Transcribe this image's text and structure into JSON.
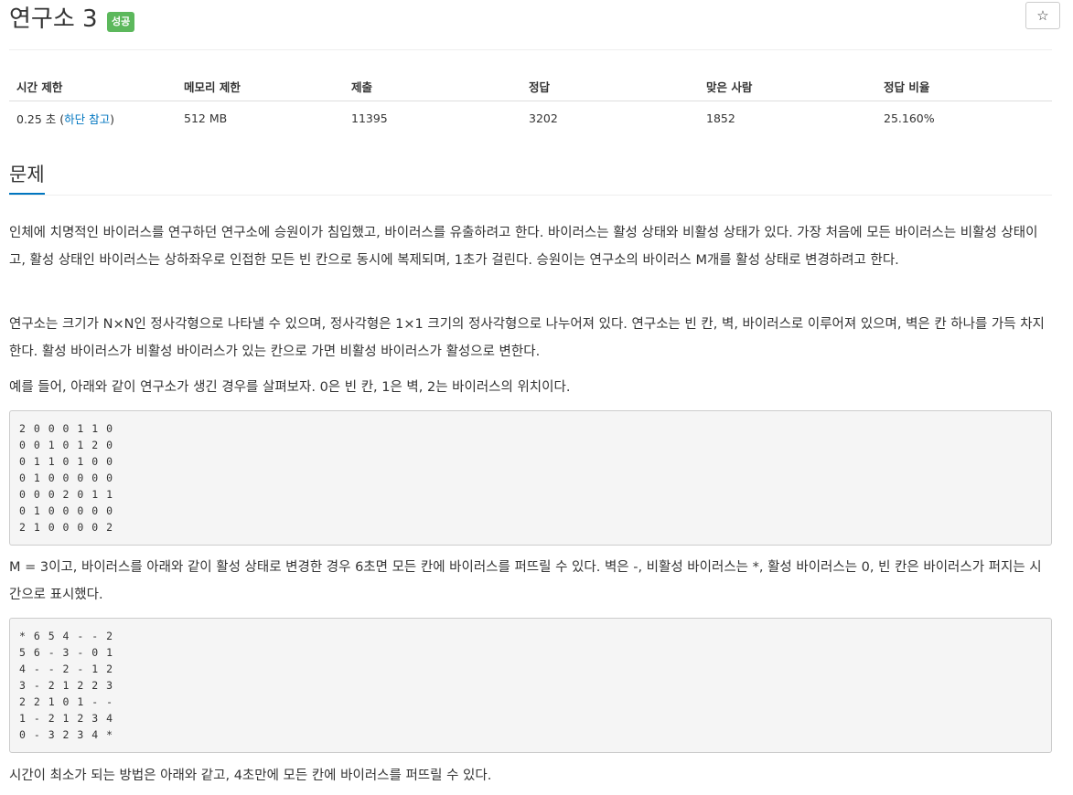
{
  "header": {
    "title": "연구소 3",
    "badge": "성공",
    "star_icon": "☆"
  },
  "info_table": {
    "headers": [
      "시간 제한",
      "메모리 제한",
      "제출",
      "정답",
      "맞은 사람",
      "정답 비율"
    ],
    "time_limit_value": "0.25 초 (",
    "time_limit_link": "하단 참고",
    "time_limit_close": ")",
    "memory_limit": "512 MB",
    "submissions": "11395",
    "accepted": "3202",
    "solvers": "1852",
    "ratio": "25.160%"
  },
  "section": {
    "title": "문제"
  },
  "paragraphs": {
    "p1": "인체에 치명적인 바이러스를 연구하던 연구소에 승원이가 침입했고, 바이러스를 유출하려고 한다. 바이러스는 활성 상태와 비활성 상태가 있다. 가장 처음에 모든 바이러스는 비활성 상태이고, 활성 상태인 바이러스는 상하좌우로 인접한 모든 빈 칸으로 동시에 복제되며, 1초가 걸린다. 승원이는 연구소의 바이러스 M개를 활성 상태로 변경하려고 한다.",
    "p2": "연구소는 크기가 N×N인 정사각형으로 나타낼 수 있으며, 정사각형은 1×1 크기의 정사각형으로 나누어져 있다. 연구소는 빈 칸, 벽, 바이러스로 이루어져 있으며, 벽은 칸 하나를 가득 차지한다. 활성 바이러스가 비활성 바이러스가 있는 칸으로 가면 비활성 바이러스가 활성으로 변한다.",
    "p3": "예를 들어, 아래와 같이 연구소가 생긴 경우를 살펴보자. 0은 빈 칸, 1은 벽, 2는 바이러스의 위치이다.",
    "p4": "M = 3이고, 바이러스를 아래와 같이 활성 상태로 변경한 경우 6초면 모든 칸에 바이러스를 퍼뜨릴 수 있다. 벽은 -, 비활성 바이러스는 *, 활성 바이러스는 0, 빈 칸은 바이러스가 퍼지는 시간으로 표시했다.",
    "p5": "시간이 최소가 되는 방법은 아래와 같고, 4초만에 모든 칸에 바이러스를 퍼뜨릴 수 있다."
  },
  "grids": {
    "grid1": "2 0 0 0 1 1 0\n0 0 1 0 1 2 0\n0 1 1 0 1 0 0\n0 1 0 0 0 0 0\n0 0 0 2 0 1 1\n0 1 0 0 0 0 0\n2 1 0 0 0 0 2",
    "grid2": "* 6 5 4 - - 2\n5 6 - 3 - 0 1\n4 - - 2 - 1 2\n3 - 2 1 2 2 3\n2 2 1 0 1 - -\n1 - 2 1 2 3 4\n0 - 3 2 3 4 *"
  }
}
